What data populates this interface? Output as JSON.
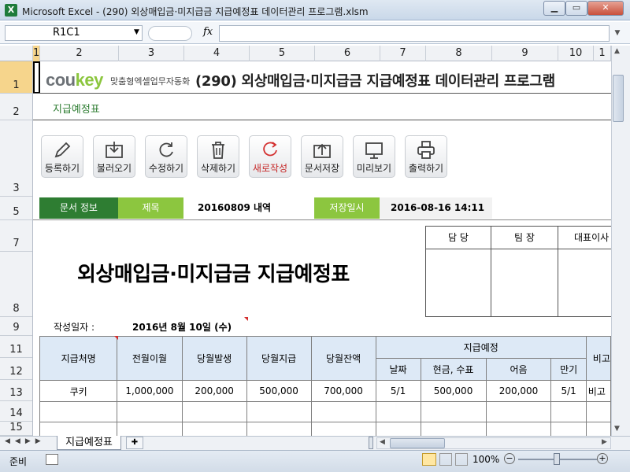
{
  "window": {
    "title": "Microsoft Excel - (290) 외상매입금·미지급금 지급예정표 데이터관리 프로그램.xlsm",
    "app_icon": "X"
  },
  "formula_bar": {
    "name_box": "R1C1",
    "fx_label": "fx",
    "formula": ""
  },
  "columns": [
    "1",
    "2",
    "3",
    "4",
    "5",
    "6",
    "7",
    "8",
    "9",
    "10",
    "1"
  ],
  "rows": [
    "1",
    "2",
    "3",
    "5",
    "7",
    "8",
    "9",
    "11",
    "12",
    "13",
    "14",
    "15"
  ],
  "logo": {
    "cou": "cou",
    "key": "key",
    "tagline": "맞춤형엑셀업무자동화"
  },
  "program_title": "(290) 외상매입금·미지급금 지급예정표 데이터관리 프로그램",
  "subtitle": "지급예정표",
  "toolbar": [
    {
      "label": "등록하기",
      "icon": "pencil-icon"
    },
    {
      "label": "불러오기",
      "icon": "load-icon"
    },
    {
      "label": "수정하기",
      "icon": "refresh-icon"
    },
    {
      "label": "삭제하기",
      "icon": "trash-icon"
    },
    {
      "label": "새로작성",
      "icon": "new-icon"
    },
    {
      "label": "문서저장",
      "icon": "save-folder-icon"
    },
    {
      "label": "미리보기",
      "icon": "preview-icon"
    },
    {
      "label": "출력하기",
      "icon": "printer-icon"
    }
  ],
  "doc_info": {
    "label": "문서 정보",
    "title_label": "제목",
    "title_value": "20160809 내역",
    "saved_label": "저장일시",
    "saved_value": "2016-08-16 14:11"
  },
  "approval": {
    "manager": "담 당",
    "team_lead": "팀 장",
    "ceo": "대표이사"
  },
  "report_title": "외상매입금·미지급금 지급예정표",
  "date_label": "작성일자 :",
  "date_value": "2016년 8월 10일 (수)",
  "table": {
    "headers": {
      "vendor": "지급처명",
      "prev_balance": "전월이월",
      "issued": "당월발생",
      "paid": "당월지급",
      "balance": "당월잔액",
      "schedule": "지급예정",
      "date": "날짜",
      "cash": "현금, 수표",
      "bill": "어음",
      "due": "만기",
      "note": "비고"
    },
    "rows": [
      {
        "vendor": "쿠키",
        "prev_balance": "1,000,000",
        "issued": "200,000",
        "paid": "500,000",
        "balance": "700,000",
        "date": "5/1",
        "cash": "500,000",
        "bill": "200,000",
        "due": "5/1",
        "note": "비고"
      }
    ]
  },
  "sheet_tab": "지급예정표",
  "status": {
    "ready": "준비",
    "zoom": "100%"
  },
  "colors": {
    "brand_green": "#8cc63f",
    "dark_green": "#2e7d32",
    "header_blue": "#dde9f6"
  }
}
